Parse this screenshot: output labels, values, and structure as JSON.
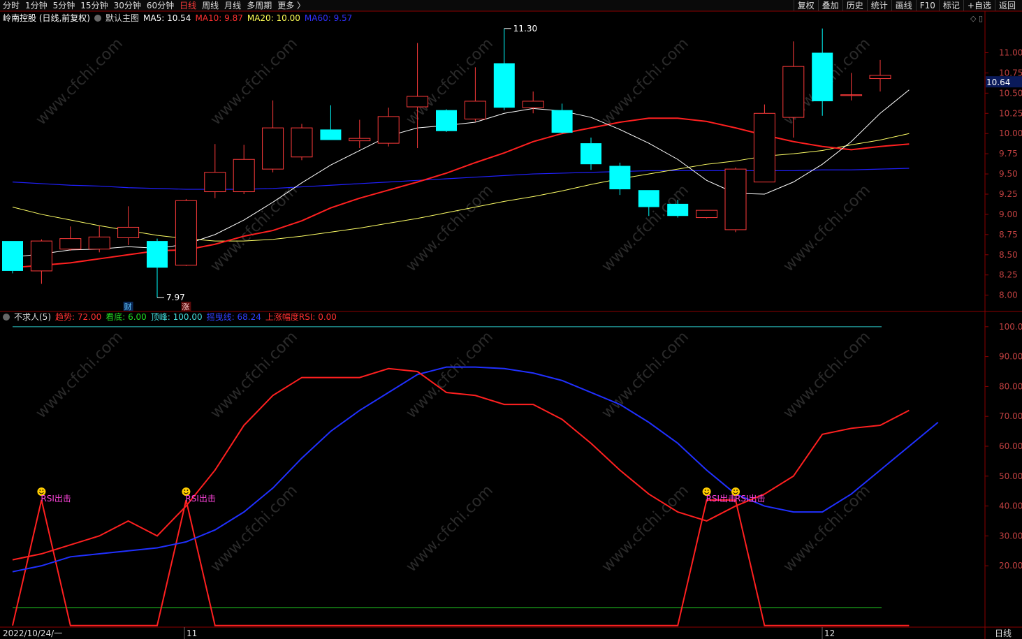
{
  "toolbar": {
    "periods": [
      "分时",
      "1分钟",
      "5分钟",
      "15分钟",
      "30分钟",
      "60分钟",
      "日线",
      "周线",
      "月线",
      "多周期",
      "更多 〉"
    ],
    "active_period": "日线",
    "right_buttons": [
      "复权",
      "叠加",
      "历史",
      "统计",
      "画线",
      "F10",
      "标记",
      "+自选",
      "返回"
    ]
  },
  "main_header": {
    "stock": "岭南控股 (日线,前复权)",
    "template": "默认主图",
    "ma5": "MA5: 10.54",
    "ma10": "MA10: 9.87",
    "ma20": "MA20: 10.00",
    "ma60": "MA60: 9.57"
  },
  "indicator_header": {
    "name": "不求人(5)",
    "trend": "趋势: 72.00",
    "bottom": "看底: 6.00",
    "peak": "顶峰: 100.00",
    "swing": "摇曳线: 68.24",
    "rsi": "上涨幅度RSI: 0.00"
  },
  "price_axis": [
    "11.00",
    "10.75",
    "10.50",
    "10.25",
    "10.00",
    "9.75",
    "9.50",
    "9.25",
    "9.00",
    "8.75",
    "8.50",
    "8.25",
    "8.00"
  ],
  "current_price": "10.64",
  "indicator_axis": [
    "100.0",
    "90.00",
    "80.00",
    "70.00",
    "60.00",
    "50.00",
    "40.00",
    "30.00",
    "20.00"
  ],
  "annotations": {
    "high_label": "11.30",
    "low_label": "7.97",
    "marker_cai": "财",
    "marker_zhang": "涨",
    "signal_label": "RSI出击"
  },
  "date_axis": {
    "start": "2022/10/24/一",
    "m11": "11",
    "m12": "12"
  },
  "bottom_right": "日线",
  "watermark": "www.cfchi.com",
  "colors": {
    "up": "#ff3b3b",
    "down": "#00ffff",
    "ma5": "#ffffff",
    "ma10": "#ff2020",
    "ma20": "#ffff66",
    "ma60": "#2020ff",
    "trend": "#ff2020",
    "swing": "#2030ff",
    "peak": "#2bc4c4",
    "bottomline": "#22cc22"
  },
  "chart_data": {
    "type": "candlestick",
    "candles": [
      {
        "o": 8.67,
        "c": 8.3,
        "h": 8.67,
        "l": 8.27
      },
      {
        "o": 8.3,
        "c": 8.67,
        "h": 8.69,
        "l": 8.14
      },
      {
        "o": 8.57,
        "c": 8.7,
        "h": 8.85,
        "l": 8.55
      },
      {
        "o": 8.57,
        "c": 8.72,
        "h": 8.86,
        "l": 8.53
      },
      {
        "o": 8.71,
        "c": 8.84,
        "h": 9.1,
        "l": 8.62
      },
      {
        "o": 8.67,
        "c": 8.34,
        "h": 8.7,
        "l": 7.97
      },
      {
        "o": 8.37,
        "c": 9.17,
        "h": 9.19,
        "l": 8.36
      },
      {
        "o": 9.28,
        "c": 9.52,
        "h": 9.87,
        "l": 9.2
      },
      {
        "o": 9.28,
        "c": 9.68,
        "h": 9.86,
        "l": 9.25
      },
      {
        "o": 9.56,
        "c": 10.07,
        "h": 10.41,
        "l": 9.52
      },
      {
        "o": 9.71,
        "c": 10.07,
        "h": 10.12,
        "l": 9.67
      },
      {
        "o": 10.05,
        "c": 9.92,
        "h": 10.35,
        "l": 9.92
      },
      {
        "o": 9.91,
        "c": 9.94,
        "h": 10.17,
        "l": 9.82
      },
      {
        "o": 9.88,
        "c": 10.21,
        "h": 10.32,
        "l": 9.84
      },
      {
        "o": 10.33,
        "c": 10.46,
        "h": 11.12,
        "l": 9.82
      },
      {
        "o": 10.29,
        "c": 10.03,
        "h": 10.3,
        "l": 10.02
      },
      {
        "o": 10.18,
        "c": 10.4,
        "h": 10.82,
        "l": 10.15
      },
      {
        "o": 10.87,
        "c": 10.32,
        "h": 11.3,
        "l": 10.29
      },
      {
        "o": 10.32,
        "c": 10.4,
        "h": 10.52,
        "l": 10.25
      },
      {
        "o": 10.29,
        "c": 10.01,
        "h": 10.37,
        "l": 10.0
      },
      {
        "o": 9.88,
        "c": 9.62,
        "h": 9.95,
        "l": 9.55
      },
      {
        "o": 9.6,
        "c": 9.31,
        "h": 9.64,
        "l": 9.24
      },
      {
        "o": 9.3,
        "c": 9.09,
        "h": 9.3,
        "l": 8.98
      },
      {
        "o": 9.13,
        "c": 8.98,
        "h": 9.18,
        "l": 8.96
      },
      {
        "o": 8.96,
        "c": 9.05,
        "h": 9.05,
        "l": 8.95
      },
      {
        "o": 8.81,
        "c": 9.56,
        "h": 9.58,
        "l": 8.78
      },
      {
        "o": 9.4,
        "c": 10.25,
        "h": 10.36,
        "l": 9.4
      },
      {
        "o": 10.2,
        "c": 10.83,
        "h": 11.14,
        "l": 9.95
      },
      {
        "o": 11.0,
        "c": 10.4,
        "h": 11.3,
        "l": 10.22
      },
      {
        "o": 10.47,
        "c": 10.48,
        "h": 10.75,
        "l": 10.41
      },
      {
        "o": 10.68,
        "c": 10.72,
        "h": 10.91,
        "l": 10.52
      }
    ],
    "ma5": [
      8.47,
      8.51,
      8.56,
      8.57,
      8.6,
      8.58,
      8.63,
      8.75,
      8.93,
      9.15,
      9.39,
      9.61,
      9.79,
      9.97,
      10.07,
      10.1,
      10.14,
      10.25,
      10.31,
      10.28,
      10.2,
      10.05,
      9.88,
      9.68,
      9.42,
      9.26,
      9.25,
      9.4,
      9.62,
      9.9,
      10.25,
      10.54
    ],
    "ma10": [
      8.34,
      8.37,
      8.4,
      8.45,
      8.5,
      8.55,
      8.56,
      8.63,
      8.73,
      8.8,
      8.92,
      9.08,
      9.2,
      9.3,
      9.4,
      9.51,
      9.64,
      9.76,
      9.9,
      10.0,
      10.07,
      10.14,
      10.19,
      10.19,
      10.15,
      10.07,
      9.98,
      9.9,
      9.84,
      9.8,
      9.84,
      9.87
    ],
    "ma20": [
      9.09,
      9.0,
      8.93,
      8.86,
      8.8,
      8.74,
      8.7,
      8.67,
      8.67,
      8.69,
      8.73,
      8.78,
      8.83,
      8.89,
      8.95,
      9.02,
      9.09,
      9.16,
      9.22,
      9.29,
      9.37,
      9.44,
      9.5,
      9.56,
      9.62,
      9.66,
      9.72,
      9.75,
      9.79,
      9.86,
      9.92,
      10.0
    ],
    "ma60": [
      9.4,
      9.38,
      9.36,
      9.35,
      9.33,
      9.32,
      9.31,
      9.31,
      9.31,
      9.32,
      9.34,
      9.36,
      9.38,
      9.4,
      9.42,
      9.44,
      9.46,
      9.48,
      9.5,
      9.51,
      9.52,
      9.53,
      9.54,
      9.54,
      9.54,
      9.54,
      9.54,
      9.54,
      9.55,
      9.55,
      9.56,
      9.57
    ],
    "trend": [
      22,
      24,
      27,
      30,
      35,
      30,
      40,
      52,
      67,
      77,
      83,
      83,
      83,
      86,
      85,
      78,
      77,
      74,
      74,
      69,
      61,
      52,
      44,
      38,
      35,
      40,
      44,
      50,
      64,
      66,
      67,
      72
    ],
    "swing": [
      18,
      20,
      23,
      24,
      25,
      26,
      28,
      32,
      38,
      46,
      56,
      65,
      72,
      78,
      84,
      86.5,
      86.5,
      86,
      84.5,
      82,
      78,
      74,
      68,
      61,
      52,
      44,
      40,
      38,
      38,
      44,
      52,
      60,
      68
    ],
    "rsi_signal": [
      0,
      42,
      0,
      0,
      0,
      0,
      42,
      0,
      0,
      0,
      0,
      0,
      0,
      0,
      0,
      0,
      0,
      0,
      0,
      0,
      0,
      0,
      0,
      0,
      42,
      42,
      0,
      0,
      0,
      0,
      0,
      0
    ],
    "signal_indices": [
      1,
      6,
      24,
      25
    ],
    "peak_level": 100,
    "bottom_level": 6,
    "price_range": [
      7.85,
      11.35
    ],
    "indicator_range": [
      -1,
      103
    ]
  }
}
